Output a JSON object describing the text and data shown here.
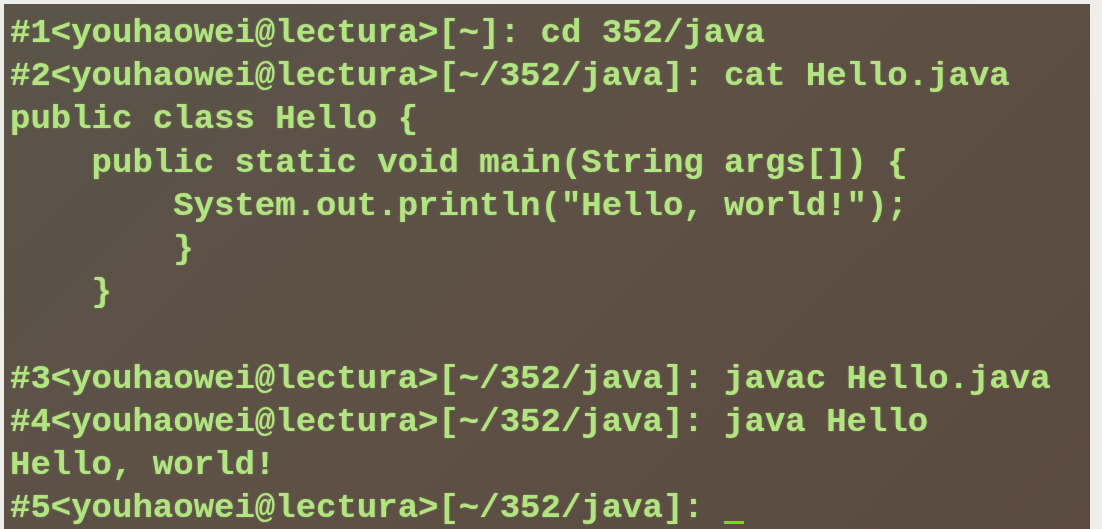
{
  "terminal": {
    "lines": [
      {
        "kind": "text",
        "text": "#1<youhaowei@lectura>[~]: cd 352/java"
      },
      {
        "kind": "text",
        "text": "#2<youhaowei@lectura>[~/352/java]: cat Hello.java"
      },
      {
        "kind": "text",
        "text": "public class Hello {"
      },
      {
        "kind": "text",
        "text": "    public static void main(String args[]) {"
      },
      {
        "kind": "text",
        "text": "        System.out.println(\"Hello, world!\");"
      },
      {
        "kind": "text",
        "text": "        }"
      },
      {
        "kind": "text",
        "text": "    }"
      },
      {
        "kind": "blank"
      },
      {
        "kind": "text",
        "text": "#3<youhaowei@lectura>[~/352/java]: javac Hello.java"
      },
      {
        "kind": "text",
        "text": "#4<youhaowei@lectura>[~/352/java]: java Hello"
      },
      {
        "kind": "text",
        "text": "Hello, world!"
      },
      {
        "kind": "input",
        "text": "#5<youhaowei@lectura>[~/352/java]: "
      }
    ]
  }
}
